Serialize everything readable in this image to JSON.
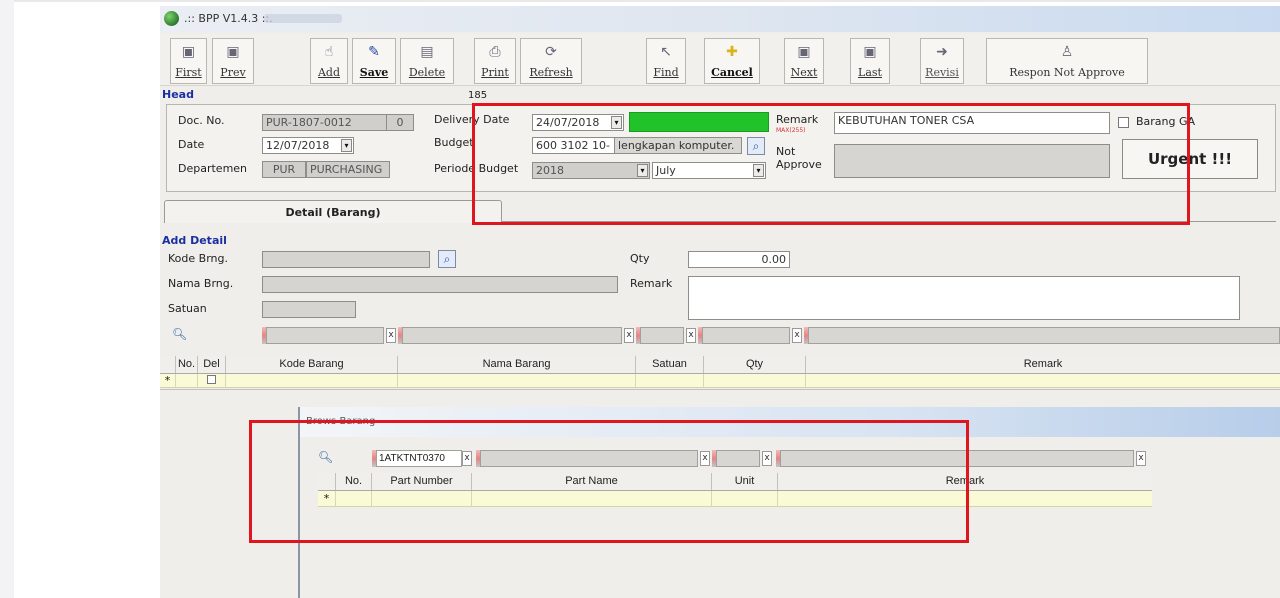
{
  "window": {
    "title": ".:: BPP V1.4.3 ::."
  },
  "toolbar": {
    "buttons": [
      {
        "label": "First",
        "icon": "first-page-icon",
        "glyph": "▣"
      },
      {
        "label": "Prev",
        "icon": "prev-icon",
        "glyph": "▣"
      },
      {
        "label": "Add",
        "icon": "add-icon",
        "glyph": "☝"
      },
      {
        "label": "Save",
        "icon": "save-icon",
        "glyph": "✎"
      },
      {
        "label": "Delete",
        "icon": "delete-icon",
        "glyph": "▤"
      },
      {
        "label": "Print",
        "icon": "print-icon",
        "glyph": "⎙"
      },
      {
        "label": "Refresh",
        "icon": "refresh-icon",
        "glyph": "⟳"
      },
      {
        "label": "Find",
        "icon": "find-icon",
        "glyph": "↖"
      },
      {
        "label": "Cancel",
        "icon": "cancel-icon",
        "glyph": "✚"
      },
      {
        "label": "Next",
        "icon": "next-icon",
        "glyph": "▣"
      },
      {
        "label": "Last",
        "icon": "last-page-icon",
        "glyph": "▣"
      },
      {
        "label": "Revisi",
        "icon": "revisi-icon",
        "glyph": "➜"
      },
      {
        "label": "Respon Not Approve",
        "icon": "respon-icon",
        "glyph": "♙"
      }
    ]
  },
  "head": {
    "section_label": "Head",
    "counter": "185",
    "doc_no_label": "Doc. No.",
    "doc_no": "PUR-1807-0012",
    "doc_no_rev": "0",
    "date_label": "Date",
    "date": "12/07/2018",
    "departemen_label": "Departemen",
    "dept_code": "PUR",
    "dept_name": "PURCHASING",
    "delivery_date_label": "Delivery Date",
    "delivery_date": "24/07/2018",
    "budget_label": "Budget",
    "budget_code": "600 3102 10-",
    "budget_name": "lengkapan komputer.",
    "periode_budget_label": "Periode Budget",
    "periode_year": "2018",
    "periode_month": "July",
    "remark_label": "Remark",
    "remark_max": "MAX(255)",
    "remark": "KEBUTUHAN TONER CSA",
    "not_approve_label": "Not Approve",
    "not_approve_line1": "Not",
    "not_approve_line2": "Approve",
    "barang_ga_label": "Barang GA",
    "urgent_label": "Urgent !!!",
    "highlight_color": "#22c22a"
  },
  "tabs": [
    {
      "label": "Detail (Barang)"
    }
  ],
  "add_detail": {
    "section_label": "Add Detail",
    "kode_label": "Kode Brng.",
    "nama_label": "Nama Brng.",
    "satuan_label": "Satuan",
    "qty_label": "Qty",
    "qty_value": "0.00",
    "remark_label": "Remark"
  },
  "detail_grid": {
    "columns": [
      "No.",
      "Del",
      "Kode Barang",
      "Nama Barang",
      "Satuan",
      "Qty",
      "Remark"
    ],
    "new_row_marker": "*"
  },
  "browse_popup": {
    "title": "Brows Barang",
    "filter_value": "1ATKTNT0370",
    "columns": [
      "No.",
      "Part Number",
      "Part Name",
      "Unit",
      "Remark"
    ],
    "new_row_marker": "*"
  },
  "colors": {
    "annotation_red": "#e0161e",
    "section_blue": "#1b2fa3"
  }
}
